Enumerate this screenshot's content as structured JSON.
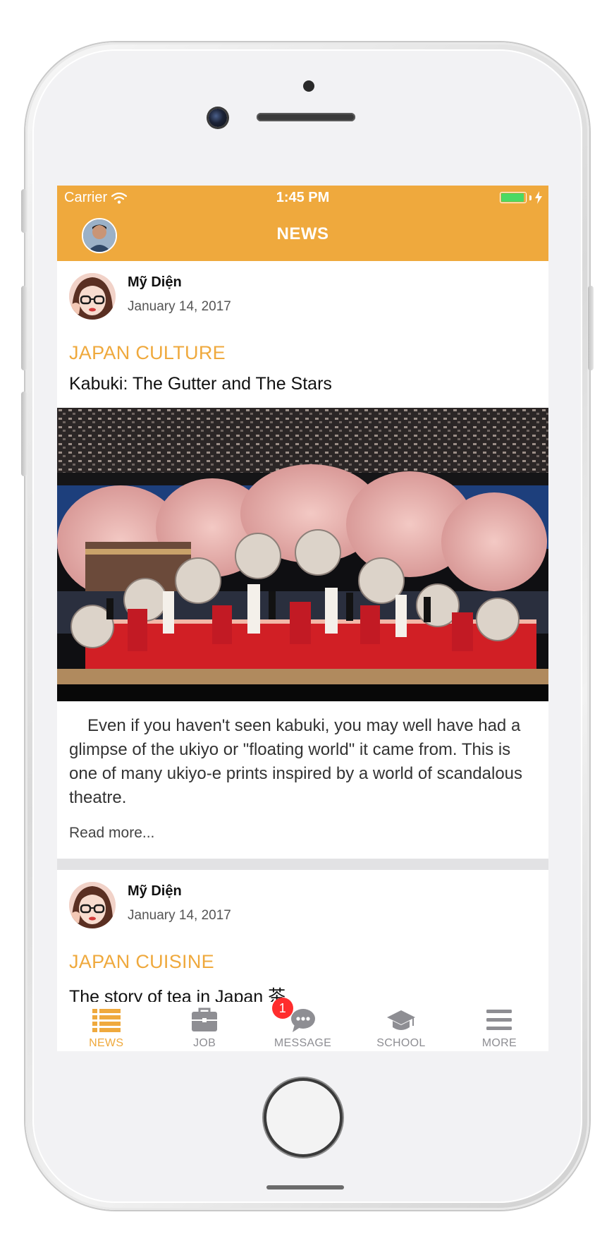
{
  "status_bar": {
    "carrier": "Carrier",
    "time": "1:45 PM",
    "battery_color": "#4cd964"
  },
  "nav_bar": {
    "title": "NEWS",
    "avatar_icon": "user-avatar",
    "background_color": "#efa93d"
  },
  "posts": [
    {
      "author": "Mỹ Diện",
      "date": "January 14, 2017",
      "category": "JAPAN CULTURE",
      "title": "Kabuki: The Gutter and The Stars",
      "excerpt": "Even if you haven't seen kabuki, you may well have had a glimpse of the ukiyo or \"floating world\" it came from. This is one of many ukiyo-e prints inspired by a world of scandalous theatre.",
      "read_more": "Read more..."
    },
    {
      "author": "Mỹ Diện",
      "date": "January 14, 2017",
      "category": "JAPAN CUISINE",
      "title": "The story of tea in Japan 茶"
    }
  ],
  "tab_bar": {
    "items": [
      {
        "label": "NEWS",
        "icon": "list-icon",
        "active": true
      },
      {
        "label": "JOB",
        "icon": "briefcase-icon",
        "active": false
      },
      {
        "label": "MESSAGE",
        "icon": "chat-bubble-icon",
        "active": false,
        "badge": "1"
      },
      {
        "label": "SCHOOL",
        "icon": "graduation-cap-icon",
        "active": false
      },
      {
        "label": "MORE",
        "icon": "menu-icon",
        "active": false
      }
    ],
    "active_color": "#efa93d",
    "inactive_color": "#8e8e93"
  }
}
